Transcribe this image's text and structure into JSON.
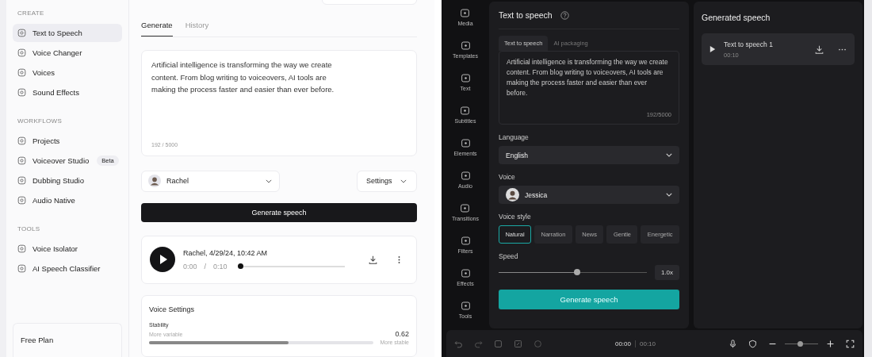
{
  "left_app": {
    "sidebar": {
      "sections": [
        {
          "heading": "CREATE",
          "items": [
            {
              "label": "Text to Speech",
              "selected": true
            },
            {
              "label": "Voice Changer",
              "selected": false
            },
            {
              "label": "Voices",
              "selected": false
            },
            {
              "label": "Sound Effects",
              "selected": false
            }
          ]
        },
        {
          "heading": "WORKFLOWS",
          "items": [
            {
              "label": "Projects",
              "selected": false
            },
            {
              "label": "Voiceover Studio",
              "selected": false,
              "badge": "Beta"
            },
            {
              "label": "Dubbing Studio",
              "selected": false
            },
            {
              "label": "Audio Native",
              "selected": false
            }
          ]
        },
        {
          "heading": "TOOLS",
          "items": [
            {
              "label": "Voice Isolator",
              "selected": false
            },
            {
              "label": "AI Speech Classifier",
              "selected": false
            }
          ]
        }
      ],
      "plan_card": {
        "title": "Free Plan"
      }
    },
    "tabs": [
      {
        "label": "Generate",
        "selected": true
      },
      {
        "label": "History",
        "selected": false
      }
    ],
    "text_input": {
      "value": "Artificial intelligence is transforming the way we create content. From blog writing to voiceovers, AI tools are making the process faster and easier than ever before.",
      "counter": "192 / 5000"
    },
    "voice_select": {
      "value": "Rachel"
    },
    "settings_button": "Settings",
    "generate_button": "Generate speech",
    "player": {
      "title": "Rachel, 4/29/24, 10:42 AM",
      "current_time": "0:00",
      "separator": "/",
      "duration": "0:10",
      "level": 0
    },
    "voice_settings": {
      "title": "Voice Settings",
      "sliders": [
        {
          "label": "Stability",
          "left_hint": "More variable",
          "right_hint": "More stable",
          "value": "0.62",
          "level": 0.62
        }
      ]
    }
  },
  "right_app": {
    "rail": [
      {
        "label": "Media"
      },
      {
        "label": "Templates"
      },
      {
        "label": "Text"
      },
      {
        "label": "Subtitles"
      },
      {
        "label": "Elements"
      },
      {
        "label": "Audio"
      },
      {
        "label": "Transitions"
      },
      {
        "label": "Filters"
      },
      {
        "label": "Effects"
      },
      {
        "label": "Tools"
      }
    ],
    "panel": {
      "title": "Text to speech",
      "tabs": [
        {
          "label": "Text to speech",
          "selected": true
        },
        {
          "label": "AI packaging",
          "selected": false
        }
      ],
      "text_input": {
        "value": "Artificial intelligence is transforming the way we create content. From blog writing to voiceovers, AI tools are making the process faster and easier than ever before.",
        "counter": "192/5000"
      },
      "language": {
        "label": "Language",
        "value": "English"
      },
      "voice": {
        "label": "Voice",
        "value": "Jessica"
      },
      "voice_style": {
        "label": "Voice style",
        "options": [
          {
            "label": "Natural",
            "selected": true
          },
          {
            "label": "Narration",
            "selected": false
          },
          {
            "label": "News",
            "selected": false
          },
          {
            "label": "Gentle",
            "selected": false
          },
          {
            "label": "Energetic",
            "selected": false
          }
        ]
      },
      "speed": {
        "label": "Speed",
        "level": 0.53,
        "value": "1.0x"
      },
      "generate_button": "Generate speech"
    },
    "generated": {
      "title": "Generated speech",
      "items": [
        {
          "title": "Text to speech 1",
          "duration": "00:10"
        }
      ]
    },
    "toolbar": {
      "current_time": "00:00",
      "duration": "00:10",
      "zoom_slider": {
        "level": 0.45
      }
    }
  }
}
